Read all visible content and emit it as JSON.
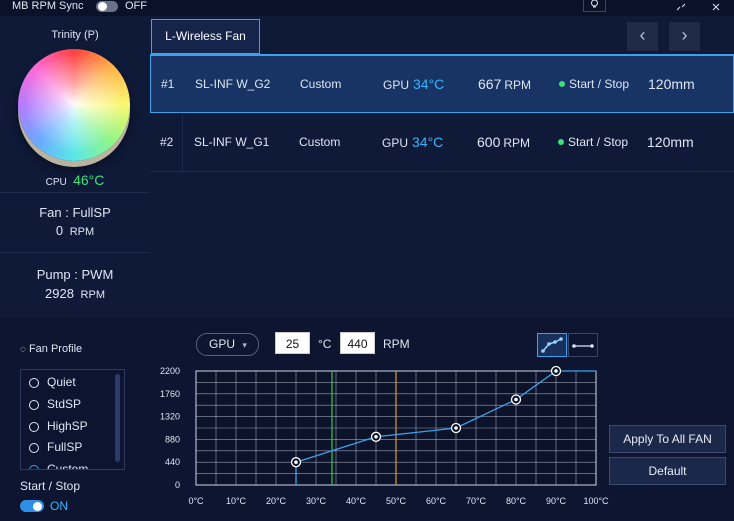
{
  "topbar": {
    "mb_sync_label": "MB RPM Sync",
    "mb_sync_state": "OFF"
  },
  "left": {
    "profile_name": "Trinity (P)",
    "cpu_label": "CPU",
    "cpu_temp": "46°C",
    "fan_label": "Fan : FullSP",
    "fan_rpm": "0",
    "pump_label": "Pump : PWM",
    "pump_rpm": "2928",
    "rpm_unit": "RPM"
  },
  "tab": {
    "label": "L-Wireless Fan"
  },
  "fans": [
    {
      "num": "#1",
      "name": "SL-INF W_G2",
      "mode": "Custom",
      "source": "GPU",
      "temp": "34°C",
      "rpm": "667",
      "rpm_unit": "RPM",
      "control": "Start / Stop",
      "size": "120mm"
    },
    {
      "num": "#2",
      "name": "SL-INF W_G1",
      "mode": "Custom",
      "source": "GPU",
      "temp": "34°C",
      "rpm": "600",
      "rpm_unit": "RPM",
      "control": "Start / Stop",
      "size": "120mm"
    }
  ],
  "profile": {
    "title": "Fan Profile",
    "items": [
      "Quiet",
      "StdSP",
      "HighSP",
      "FullSP",
      "Custom"
    ],
    "start_stop_label": "Start / Stop",
    "start_stop_state": "ON"
  },
  "curve_controls": {
    "source": "GPU",
    "temp_value": "25",
    "temp_unit": "°C",
    "rpm_value": "440",
    "rpm_unit": "RPM"
  },
  "buttons": {
    "apply_all": "Apply To All FAN",
    "default": "Default"
  },
  "colors": {
    "accent": "#3ea2ea",
    "temp_blue": "#39b3ff",
    "cpu_green": "#3be07a",
    "current_temp_line": "#3cc85a",
    "limit_line": "#d49a3a"
  },
  "chart_data": {
    "type": "line",
    "x_ticks": [
      "0°C",
      "10°C",
      "20°C",
      "30°C",
      "40°C",
      "50°C",
      "60°C",
      "70°C",
      "80°C",
      "90°C",
      "100°C"
    ],
    "y_ticks": [
      "0",
      "440",
      "880",
      "1320",
      "1760",
      "2200"
    ],
    "xlim": [
      0,
      100
    ],
    "ylim": [
      0,
      2200
    ],
    "points": [
      {
        "x": 25,
        "y": 440
      },
      {
        "x": 45,
        "y": 930
      },
      {
        "x": 65,
        "y": 1100
      },
      {
        "x": 80,
        "y": 1650
      },
      {
        "x": 90,
        "y": 2200
      }
    ],
    "current_temp": 34,
    "limit_temp": 50,
    "grid": true
  }
}
